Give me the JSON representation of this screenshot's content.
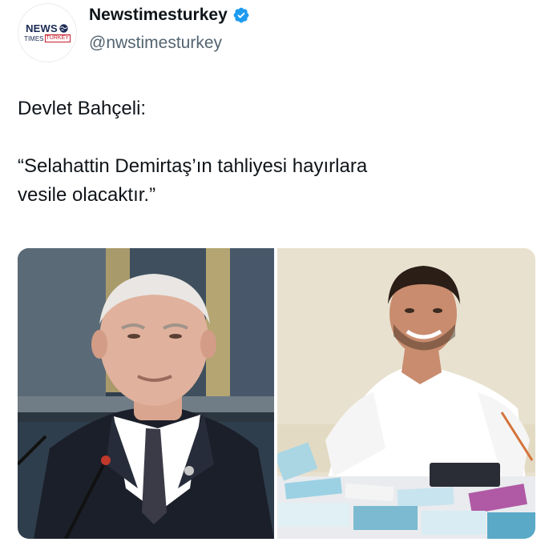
{
  "account": {
    "display_name": "Newstimesturkey",
    "handle": "@nwstimesturkey",
    "verified_icon": "verified-badge-icon",
    "logo": {
      "line1": "NEWS",
      "line2_left": "TIMES",
      "line2_right": "TURKEY"
    }
  },
  "tweet": {
    "lines": [
      "Devlet Bahçeli:",
      "“Selahattin Demirtaş’ın tahliyesi hayırlara",
      "vesile olacaktır.”"
    ]
  },
  "media": {
    "photos": [
      "photo-left",
      "photo-right"
    ]
  },
  "colors": {
    "text": "#0f1419",
    "secondary": "#536471",
    "verified": "#1d9bf0",
    "brand_navy": "#1b2a55",
    "brand_red": "#c41e2a"
  }
}
